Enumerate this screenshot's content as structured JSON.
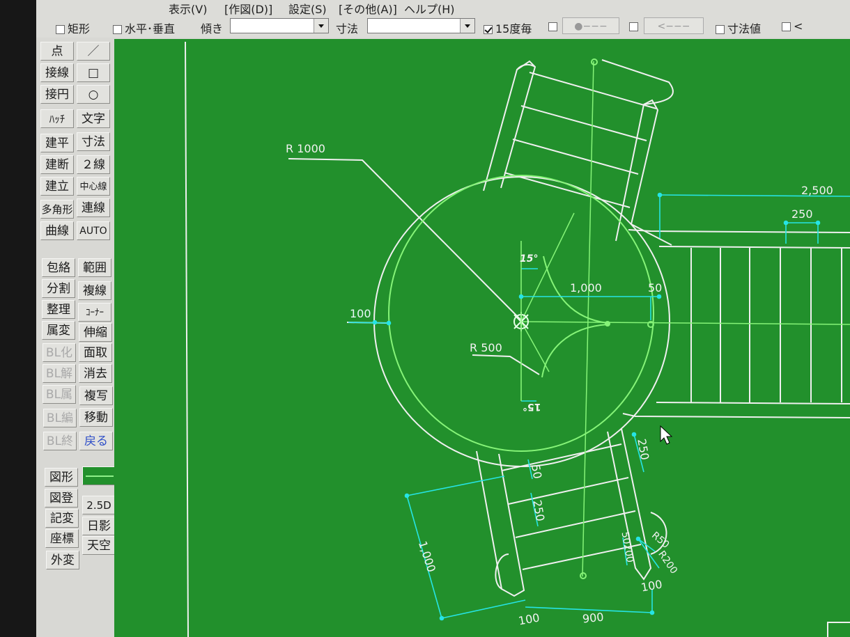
{
  "menu": [
    {
      "label": "表示(V)"
    },
    {
      "label": "[作図(D)]"
    },
    {
      "label": "設定(S)"
    },
    {
      "label": "[その他(A)]"
    },
    {
      "label": "ヘルプ(H)"
    }
  ],
  "toolbar": {
    "rect_label": "矩形",
    "horiz_vert_label": "水平･垂直",
    "tilt_label": "傾き",
    "tilt_value": "",
    "dim_label": "寸法",
    "dim_value": "",
    "deg15_label": "15度毎",
    "dot_btn_label": "●−−−",
    "arrow_btn_label": "<−−−",
    "dimval_label": "寸法値",
    "lt_label": "<"
  },
  "palette": {
    "left": [
      "点",
      "接線",
      "接円",
      "ﾊｯﾁ",
      "建平",
      "建断",
      "建立",
      "多角形",
      "曲線",
      "包絡",
      "分割",
      "整理",
      "属変",
      "BL化",
      "BL解",
      "BL属",
      "BL編",
      "BL終",
      "図形",
      "図登",
      "記変",
      "座標",
      "外変"
    ],
    "right": [
      "／",
      "□",
      "○",
      "文字",
      "寸法",
      "２線",
      "中心線",
      "連線",
      "AUTO",
      "範囲",
      "複線",
      "ｺｰﾅｰ",
      "伸縮",
      "面取",
      "消去",
      "複写",
      "移動",
      "戻る",
      "2.5D",
      "日影",
      "天空"
    ]
  },
  "drawing": {
    "labels": {
      "r1000": "R  1000",
      "r500": "R 500",
      "d100_left": "100",
      "d15_top": "15°",
      "d15_bottom": "15°",
      "d1000_h": "1,000",
      "d50_h": "50",
      "d2500": "2,500",
      "d250_top": "250",
      "d250_right": "250",
      "d50_a": "50",
      "d250_mid": "250",
      "d1000_v": "1,000",
      "d50200": "50200",
      "r50": "R50",
      "r200": "R200",
      "d100_r": "100",
      "d100_b": "100",
      "d900": "900"
    },
    "colors": {
      "background": "#22902c",
      "white": "#f2f2f2",
      "cyan": "#22e6e6",
      "selected": "#7cff6a"
    }
  }
}
